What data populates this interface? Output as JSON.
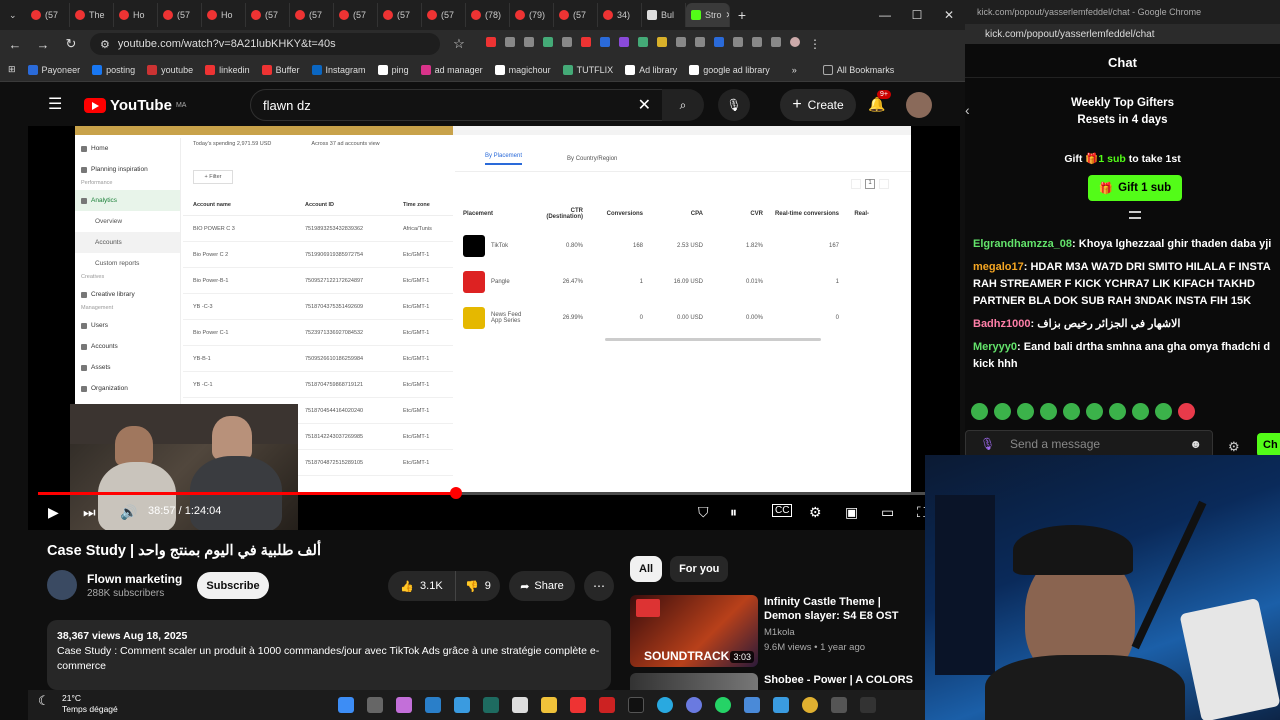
{
  "browser": {
    "tabs": [
      {
        "label": "(57",
        "icon": "youtube-icon"
      },
      {
        "label": "The",
        "icon": "youtube-icon"
      },
      {
        "label": "Ho",
        "icon": "youtube-icon"
      },
      {
        "label": "(57",
        "icon": "youtube-icon"
      },
      {
        "label": "Ho",
        "icon": "youtube-icon"
      },
      {
        "label": "(57",
        "icon": "youtube-icon"
      },
      {
        "label": "(57",
        "icon": "youtube-icon"
      },
      {
        "label": "(57",
        "icon": "youtube-icon"
      },
      {
        "label": "(57",
        "icon": "youtube-icon"
      },
      {
        "label": "(57",
        "icon": "youtube-icon"
      },
      {
        "label": "(78)",
        "icon": "youtube-icon"
      },
      {
        "label": "(79)",
        "icon": "youtube-icon"
      },
      {
        "label": "(57",
        "icon": "youtube-icon"
      },
      {
        "label": "34)",
        "icon": "youtube-icon"
      },
      {
        "label": "Bul",
        "icon": "stack-icon"
      },
      {
        "label": "Stro",
        "icon": "kick-icon"
      }
    ],
    "url": "youtube.com/watch?v=8A21lubKHKY&t=40s",
    "bookmarks": [
      "Payoneer",
      "posting",
      "youtube",
      "linkedin",
      "Buffer",
      "Instagram",
      "ping",
      "ad manager",
      "magichour",
      "TUTFLIX",
      "Ad library",
      "google ad library"
    ],
    "all_bookmarks": "All Bookmarks"
  },
  "youtube": {
    "logo": "YouTube",
    "region": "MA",
    "search_value": "flawn dz",
    "create_label": "Create",
    "notif_count": "9+",
    "video": {
      "time": "38:57 / 1:24:04",
      "progress": 0.47
    },
    "title": "ألف طلبية في اليوم بمنتج واحد | Case Study",
    "channel": {
      "name": "Flown marketing",
      "subs": "288K subscribers"
    },
    "subscribe": "Subscribe",
    "likes": "3.1K",
    "dislikes": "9",
    "share": "Share",
    "desc": {
      "meta": "38,367 views  Aug 18, 2025",
      "text": "Case Study : Comment scaler un produit à 1000 commandes/jour avec TikTok Ads grâce à une stratégie complète e-commerce"
    },
    "chips": [
      "All",
      "For you"
    ],
    "recs": [
      {
        "title": "Infinity Castle Theme | Demon slayer: S4 E8 OST",
        "channel": "M1kola",
        "meta": "9.6M views • 1 year ago",
        "duration": "3:03",
        "thumb_text": "SOUNDTRACK"
      },
      {
        "title": "Shobee - Power | A COLORS",
        "channel": "",
        "meta": "",
        "duration": "",
        "thumb_text": ""
      }
    ]
  },
  "screen_content": {
    "spending": "Today's spending  2,971.59 USD",
    "across": "Across 37 ad accounts  view",
    "filter": "+ Filter",
    "nav": [
      {
        "label": "Home",
        "kind": "item"
      },
      {
        "label": "Planning inspiration",
        "kind": "item"
      },
      {
        "label": "Performance",
        "kind": "section"
      },
      {
        "label": "Analytics",
        "kind": "active"
      },
      {
        "label": "Overview",
        "kind": "sub"
      },
      {
        "label": "Accounts",
        "kind": "subact"
      },
      {
        "label": "Custom reports",
        "kind": "sub"
      },
      {
        "label": "Creatives",
        "kind": "section"
      },
      {
        "label": "Creative library",
        "kind": "item"
      },
      {
        "label": "Management",
        "kind": "section"
      },
      {
        "label": "Users",
        "kind": "item"
      },
      {
        "label": "Accounts",
        "kind": "item"
      },
      {
        "label": "Assets",
        "kind": "item"
      },
      {
        "label": "Organization",
        "kind": "item"
      }
    ],
    "acc_headers": [
      "Account name",
      "Account ID",
      "Time zone"
    ],
    "acc_rows": [
      [
        "BIO POWER C 3",
        "7519893253432839362",
        "Africa/Tunis"
      ],
      [
        "Bio Power C 2",
        "7519906919385972754",
        "Etc/GMT-1"
      ],
      [
        "Bio Power-B-1",
        "7509527122172624897",
        "Etc/GMT-1"
      ],
      [
        "YB -C-3",
        "7518704375351492609",
        "Etc/GMT-1"
      ],
      [
        "Bio Power C-1",
        "7523971336927084532",
        "Etc/GMT-1"
      ],
      [
        "YB-B-1",
        "7509526610186259984",
        "Etc/GMT-1"
      ],
      [
        "YB -C-1",
        "7518704759868719121",
        "Etc/GMT-1"
      ],
      [
        "",
        "7518704544164020240",
        "Etc/GMT-1"
      ],
      [
        "",
        "7518142243037269985",
        "Etc/GMT-1"
      ],
      [
        "",
        "7518704872515289105",
        "Etc/GMT-1"
      ]
    ],
    "tabs": [
      "By Placement",
      "By Country/Region"
    ],
    "pl_headers": [
      "Placement",
      "CTR (Destination)",
      "Conversions",
      "CPA",
      "CVR",
      "Real-time conversions",
      "Real-"
    ],
    "pl_rows": [
      [
        "TikTok",
        "0.80%",
        "168",
        "2.53 USD",
        "1.82%",
        "167"
      ],
      [
        "Pangle",
        "26.47%",
        "1",
        "16.09 USD",
        "0.01%",
        "1"
      ],
      [
        "News Feed App Series",
        "26.99%",
        "0",
        "0.00 USD",
        "0.00%",
        "0"
      ]
    ],
    "page": "1"
  },
  "kick": {
    "window_title": "kick.com/popout/yasserlemfeddel/chat - Google Chrome",
    "url": "kick.com/popout/yasserlemfeddel/chat",
    "chat_title": "Chat",
    "gifters": "Weekly Top Gifters",
    "resets": "Resets in 4 days",
    "gift_line_a": "Gift",
    "gift_line_b": "1 sub",
    "gift_line_c": "to take 1st",
    "gift_btn": "Gift 1 sub",
    "messages": [
      {
        "user": "Elgrandhamzza_08",
        "color": "#63e36b",
        "text": "Khoya lghezzaal ghir thaden daba yji"
      },
      {
        "user": "megalo17",
        "color": "#f5a623",
        "text": "HDAR M3A WA7D DRI SMITO HILALA F INSTA RAH STREAMER F KICK YCHRA7 LIK KIFACH TAKHD PARTNER BLA DOK SUB RAH 3NDAK INSTA FIH 15K"
      },
      {
        "user": "Badhz1000",
        "color": "#ff7fa8",
        "text": "الاشهار في الجزائر رخيص بزاف"
      },
      {
        "user": "Meryyy0",
        "color": "#63e36b",
        "text": "Eand bali drtha smhna ana gha omya fhadchi d kick hhh"
      }
    ],
    "send_placeholder": "Send a message",
    "chat_btn": "Ch"
  },
  "taskbar": {
    "temp": "21°C",
    "weather": "Temps dégagé"
  }
}
